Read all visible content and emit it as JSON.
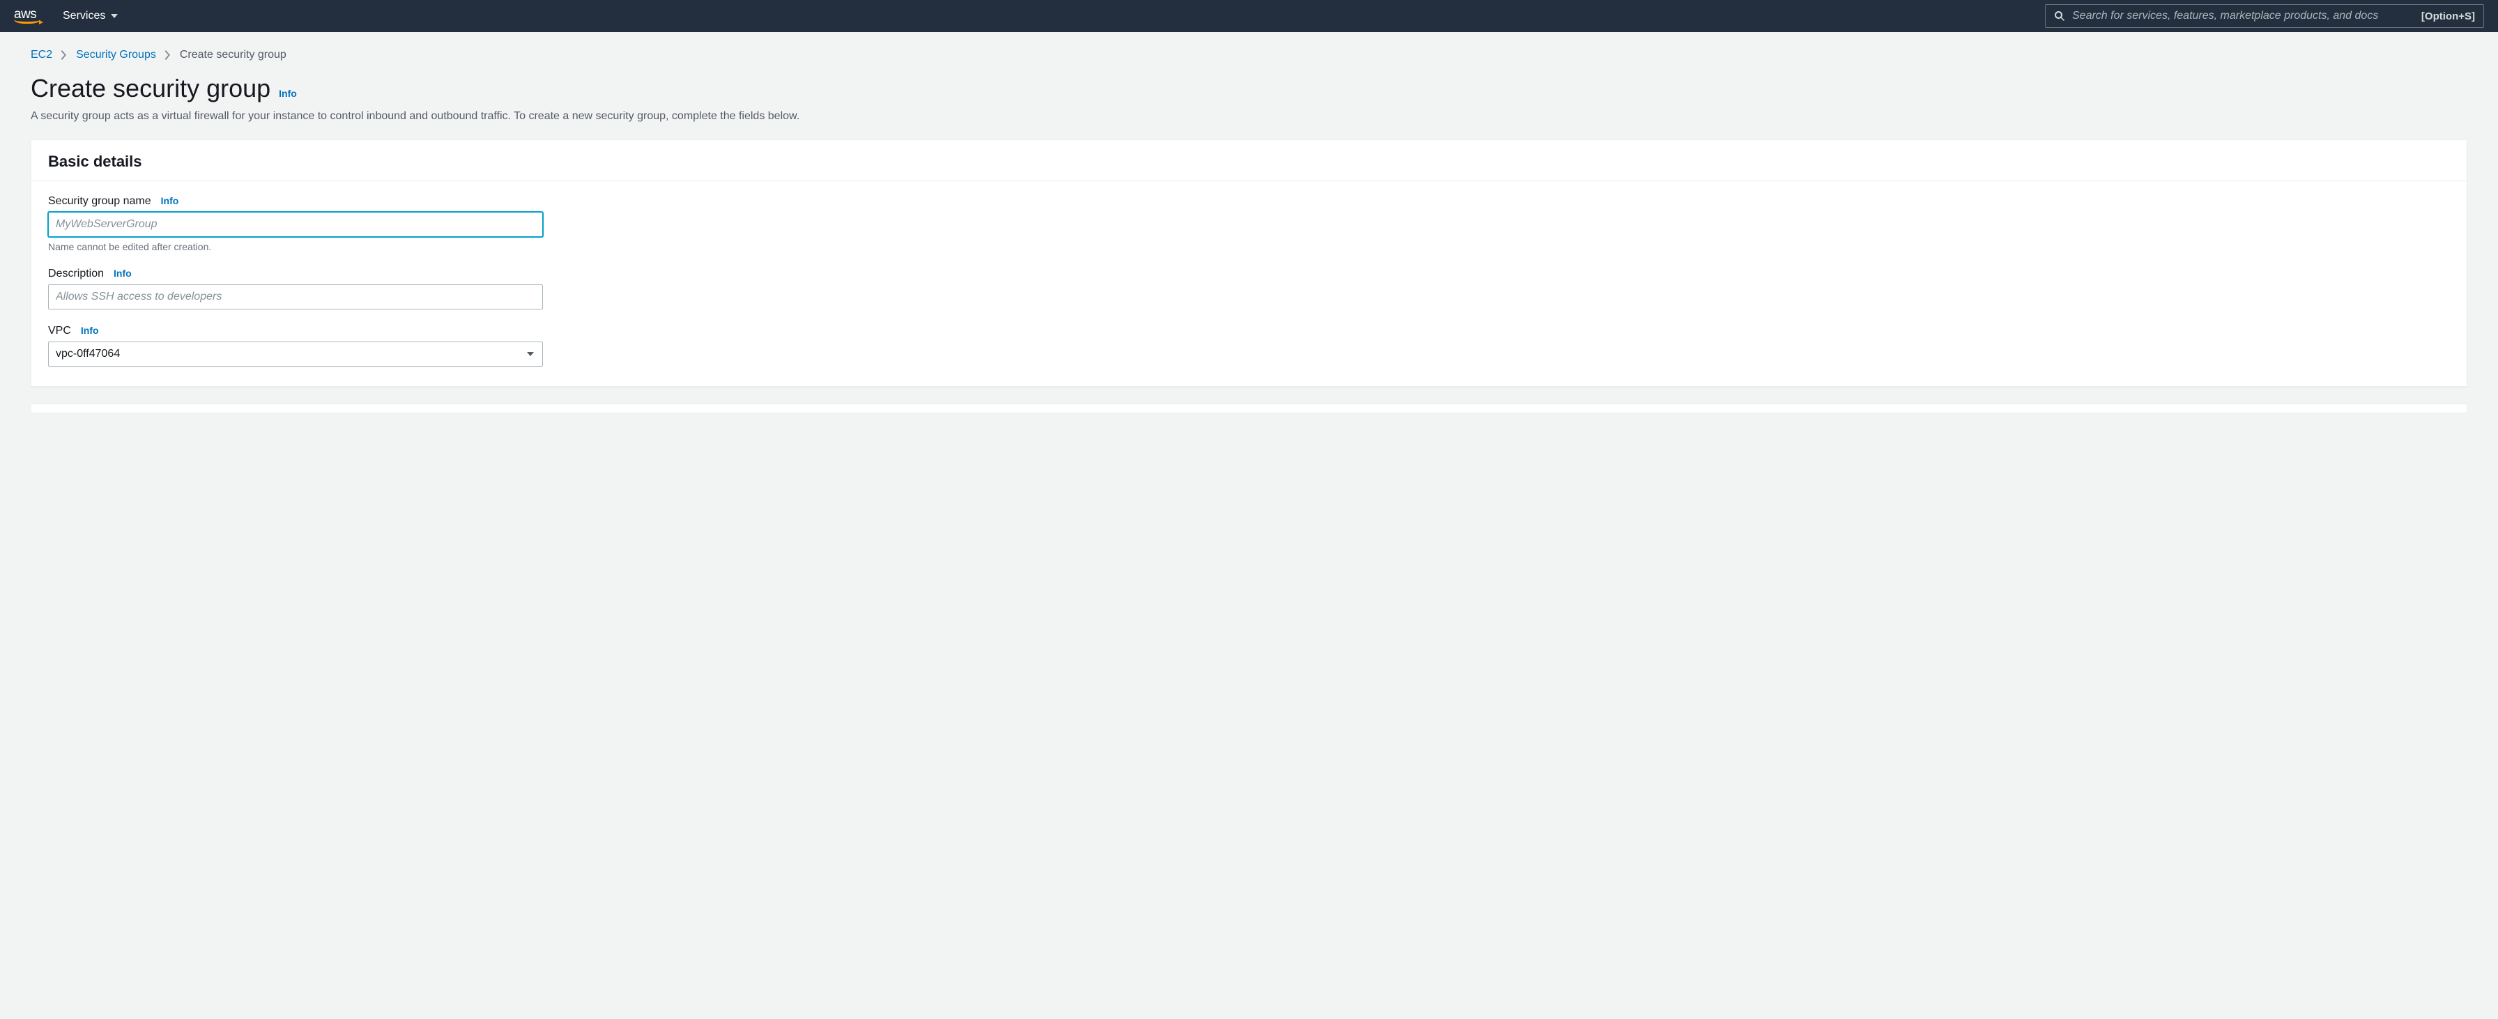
{
  "header": {
    "logo_text": "aws",
    "services_label": "Services",
    "search_placeholder": "Search for services, features, marketplace products, and docs",
    "search_shortcut": "[Option+S]"
  },
  "breadcrumb": {
    "items": [
      {
        "label": "EC2",
        "link": true
      },
      {
        "label": "Security Groups",
        "link": true
      },
      {
        "label": "Create security group",
        "link": false
      }
    ]
  },
  "page": {
    "title": "Create security group",
    "info_label": "Info",
    "description": "A security group acts as a virtual firewall for your instance to control inbound and outbound traffic. To create a new security group, complete the fields below."
  },
  "panel_basic": {
    "title": "Basic details",
    "fields": {
      "name": {
        "label": "Security group name",
        "info": "Info",
        "value": "",
        "placeholder": "MyWebServerGroup",
        "hint": "Name cannot be edited after creation."
      },
      "description": {
        "label": "Description",
        "info": "Info",
        "value": "",
        "placeholder": "Allows SSH access to developers"
      },
      "vpc": {
        "label": "VPC",
        "info": "Info",
        "selected": "vpc-0ff47064"
      }
    }
  }
}
